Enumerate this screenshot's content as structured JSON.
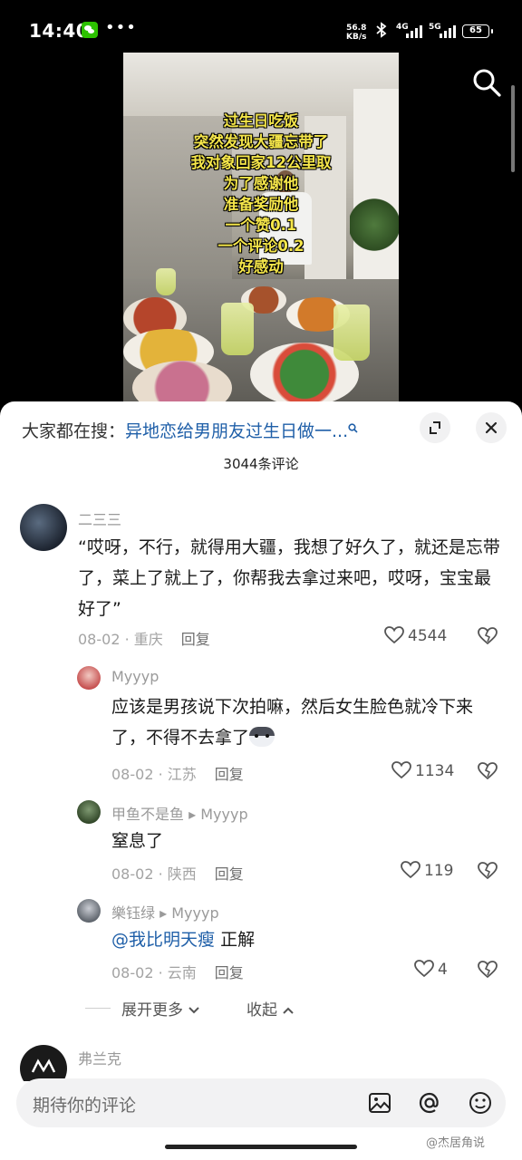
{
  "status_bar": {
    "time": "14:40",
    "net_speed_value": "56.8",
    "net_speed_unit": "KB/s",
    "signal_1": "4G",
    "signal_2": "5G",
    "battery": "65",
    "icons": [
      "wechat-icon",
      "more-dots-icon",
      "bluetooth-icon",
      "signal-icon",
      "battery-icon"
    ]
  },
  "video": {
    "caption_lines": [
      "过生日吃饭",
      "突然发现大疆忘带了",
      "我对象回家12公里取",
      "为了感谢他",
      "准备奖励他",
      "一个赞0.1",
      "一个评论0.2",
      "好感动"
    ],
    "search_icon": "search-icon"
  },
  "sheet": {
    "search_prefix": "大家都在搜：",
    "search_query": "异地恋给男朋友过生日做一...",
    "comment_count": "3044条评论",
    "input_placeholder": "期待你的评论",
    "input_icons": [
      "image-icon",
      "at-icon",
      "emoji-icon"
    ]
  },
  "comments": [
    {
      "author": "二三三",
      "text": "“哎呀，不行，就得用大疆，我想了好久了，就还是忘带了，菜上了就上了，你帮我去拿过来吧，哎呀，宝宝最好了”",
      "date": "08-02",
      "location": "重庆",
      "reply_label": "回复",
      "likes": "4544"
    }
  ],
  "replies": [
    {
      "author": "Myyyp",
      "text": "应该是男孩说下次拍嘛，然后女生脸色就冷下来了，不得不去拿了",
      "date": "08-02",
      "location": "江苏",
      "reply_label": "回复",
      "likes": "1134"
    },
    {
      "author": "甲鱼不是鱼",
      "reply_to": "Myyyp",
      "text": "窒息了",
      "date": "08-02",
      "location": "陕西",
      "reply_label": "回复",
      "likes": "119"
    },
    {
      "author": "樂钰绿",
      "reply_to": "Myyyp",
      "mention": "@我比明天瘦",
      "text": "正解",
      "date": "08-02",
      "location": "云南",
      "reply_label": "回复",
      "likes": "4"
    }
  ],
  "thread_controls": {
    "expand_more": "展开更多",
    "collapse": "收起"
  },
  "next_comment": {
    "author": "弗兰克"
  },
  "watermark": "@杰居角说"
}
